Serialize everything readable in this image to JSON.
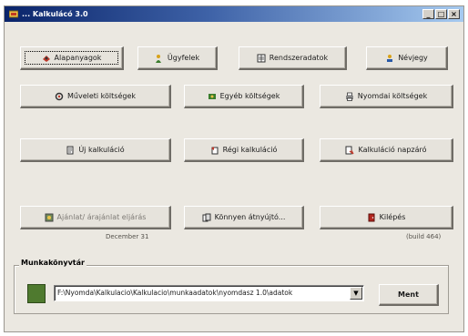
{
  "window": {
    "title": "... Kalkulácó 3.0",
    "min_label": "_",
    "max_label": "□",
    "close_label": "×"
  },
  "buttons": {
    "alapanyagok": "Alapanyagok",
    "ugyfelek": "Ügyfelek",
    "rendszeradatok": "Rendszeradatok",
    "nevjegy": "Névjegy",
    "munkalati": "Műveleti költségek",
    "egyeb": "Egyéb költségek",
    "nyomdai": "Nyomdai költségek",
    "uj": "Új kalkuláció",
    "regi": "Régi kalkuláció",
    "napzaro": "Kalkuláció napzáró",
    "ajanlat": "Ajánlat/ árajánlat eljárás",
    "konnyebb": "Könnyen átnyújtó...",
    "kilepes": "Kilépés"
  },
  "labels": {
    "date": "December 31",
    "version": "(build 464)"
  },
  "workdir": {
    "group_title": "Munkakönyvtár",
    "path": "F:\\Nyomda\\Kalkulacio\\Kalkulacio\\munkaadatok\\nyomdasz 1.0\\adatok",
    "save_label": "Ment"
  },
  "colors": {
    "titlebar_start": "#0a246a",
    "swatch": "#4f7a2f"
  },
  "icons": {
    "app": "app-icon",
    "alapanyagok": "ingredients-icon",
    "ugyfelek": "customers-icon",
    "rendszeradatok": "system-data-icon",
    "nevjegy": "about-icon",
    "munkalati": "operations-icon",
    "egyeb": "other-costs-icon",
    "nyomdai": "printer-icon",
    "uj": "new-document-icon",
    "regi": "open-document-icon",
    "napzaro": "day-close-icon",
    "ajanlat": "offer-icon",
    "konnyebb": "handover-icon",
    "kilepes": "exit-icon"
  }
}
